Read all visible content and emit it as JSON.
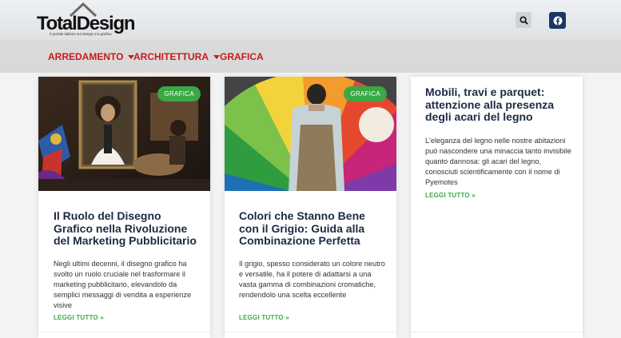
{
  "header": {
    "logo_text_1": "Total",
    "logo_text_2": "Design",
    "logo_tagline": "Il portale italiano sul design e la grafica",
    "search_icon": "search-icon",
    "social_icon": "facebook-icon"
  },
  "nav": {
    "items": [
      {
        "label": "ARREDAMENTO",
        "has_dropdown": true
      },
      {
        "label": "ARCHITETTURA",
        "has_dropdown": true
      },
      {
        "label": "GRAFICA",
        "has_dropdown": false
      }
    ]
  },
  "articles": [
    {
      "badge": "GRAFICA",
      "title": "Il Ruolo del Disegno Grafico nella Rivoluzione del Marketing Pubblicitario",
      "excerpt": "Negli ultimi decenni, il disegno grafico ha svolto un ruolo cruciale nel trasformare il marketing pubblicitario, elevandolo da semplici messaggi di vendita a esperienze visive",
      "more": "LEGGI TUTTO »"
    },
    {
      "badge": "GRAFICA",
      "title": "Colori che Stanno Bene con il Grigio: Guida alla Combinazione Perfetta",
      "excerpt": "Il grigio, spesso considerato un colore neutro e versatile, ha il potere di adattarsi a una vasta gamma di combinazioni cromatiche, rendendolo una scelta eccellente",
      "more": "LEGGI TUTTO »"
    },
    {
      "title": "Mobili, travi e parquet: attenzione alla presenza degli acari del legno",
      "excerpt": "L'eleganza del legno nelle nostre abitazioni può nascondere una minaccia tanto invisibile quanto dannosa: gli acari del legno, conosciuti scientificamente con il nome di Pyemotes",
      "more": "LEGGI TUTTO »"
    }
  ],
  "colors": {
    "nav_text": "#c8191b",
    "accent_green": "#3aa845",
    "title_navy": "#1c2a44",
    "facebook_bg": "#1b3566"
  }
}
